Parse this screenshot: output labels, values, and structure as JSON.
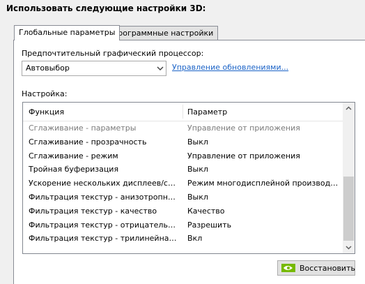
{
  "heading": "Использовать следующие настройки 3D:",
  "tabs": [
    {
      "label": "Глобальные параметры",
      "active": true
    },
    {
      "label": "Программные настройки",
      "active": false
    }
  ],
  "gpu": {
    "label": "Предпочтительный графический процессор:",
    "value": "Автовыбор",
    "link": "Управление обновлениями..."
  },
  "settings": {
    "label": "Настройка:",
    "columns": [
      "Функция",
      "Параметр"
    ],
    "rows": [
      {
        "feature": "Сглаживание - параметры",
        "value": "Управление от приложения",
        "disabled": true
      },
      {
        "feature": "Сглаживание - прозрачность",
        "value": "Выкл",
        "disabled": false
      },
      {
        "feature": "Сглаживание - режим",
        "value": "Управление от приложения",
        "disabled": false
      },
      {
        "feature": "Тройная буферизация",
        "value": "Выкл",
        "disabled": false
      },
      {
        "feature": "Ускорение нескольких дисплеев/смеша...",
        "value": "Режим многодисплейной производител...",
        "disabled": false
      },
      {
        "feature": "Фильтрация текстур - анизотропная оп...",
        "value": "Выкл",
        "disabled": false
      },
      {
        "feature": "Фильтрация текстур - качество",
        "value": "Качество",
        "disabled": false
      },
      {
        "feature": "Фильтрация текстур - отрицательное о...",
        "value": "Разрешить",
        "disabled": false
      },
      {
        "feature": "Фильтрация текстур - трилинейная опт...",
        "value": "Вкл",
        "disabled": false
      }
    ]
  },
  "restore_label": "Восстановить",
  "icons": {
    "dropdown": "chevron-down-icon",
    "scroll_up": "scroll-up-icon",
    "scroll_down": "scroll-down-icon",
    "restore": "nvidia-logo-icon"
  },
  "colors": {
    "link": "#1b63c7",
    "disabled_text": "#7a7a7a",
    "nvidia_green": "#76b900"
  }
}
